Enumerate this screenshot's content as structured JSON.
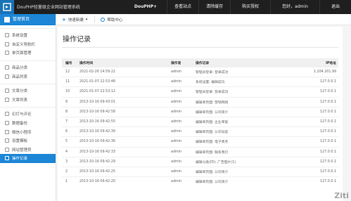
{
  "app": {
    "title": "DouPHP轻量级企业网站管理系统"
  },
  "topnav": {
    "items": [
      "DouPHP+",
      "查看站点",
      "清除缓存",
      "购买授权",
      "您好，admin",
      "退出"
    ]
  },
  "sidebar": {
    "header": "管理首页",
    "groups": [
      [
        "系统设置",
        "自定义导航栏",
        "单页面管理"
      ],
      [
        "商品分类",
        "商品列表"
      ],
      [
        "文章分类",
        "文章列表"
      ],
      [
        "幻灯与评论",
        "数据备份",
        "微信小程序",
        "设置模板",
        "网站管理员",
        "操作记录"
      ]
    ],
    "active": "操作记录"
  },
  "toolbar": {
    "quick_new": "快速新建",
    "help": "帮助中心"
  },
  "main": {
    "title": "操作记录",
    "columns": [
      "编号",
      "操作时间",
      "操作者",
      "操作记录",
      "IP地址"
    ],
    "rows": [
      [
        "12",
        "2021-02-26 14:59:22",
        "admin",
        "管理员登录: 登录成功",
        "1.204.201.99"
      ],
      [
        "11",
        "2021-01-07 22:53:48",
        "admin",
        "系统设置: 编辑成功",
        "127.0.0.1"
      ],
      [
        "10",
        "2021-01-07 22:53:12",
        "admin",
        "管理员登录: 登录成功",
        "127.0.0.1"
      ],
      [
        "9",
        "2013-10-16 09:43:01",
        "admin",
        "编辑单页面: 营销网络",
        "127.0.0.1"
      ],
      [
        "8",
        "2013-10-16 09:42:58",
        "admin",
        "编辑单页面: 公司简介",
        "127.0.0.1"
      ],
      [
        "7",
        "2013-10-16 09:42:55",
        "admin",
        "编辑单页面: 企业荣誉",
        "127.0.0.1"
      ],
      [
        "6",
        "2013-10-16 09:42:39",
        "admin",
        "编辑单页面: 公司动态",
        "127.0.0.1"
      ],
      [
        "5",
        "2013-10-16 09:42:36",
        "admin",
        "编辑单页面: 电子商务",
        "127.0.0.1"
      ],
      [
        "4",
        "2013-10-16 09:42:33",
        "admin",
        "编辑单页面: 联系我们",
        "127.0.0.1"
      ],
      [
        "3",
        "2013-10-16 09:42:29",
        "admin",
        "编辑分类(ID): 广告图片(1)",
        "127.0.0.1"
      ],
      [
        "2",
        "2013-10-16 09:42:25",
        "admin",
        "编辑单页面: 公司简介",
        "127.0.0.1"
      ],
      [
        "1",
        "2013-10-16 09:42:20",
        "admin",
        "编辑单页面: 公司简介",
        "127.0.0.1"
      ]
    ]
  },
  "watermark": "Ziti"
}
